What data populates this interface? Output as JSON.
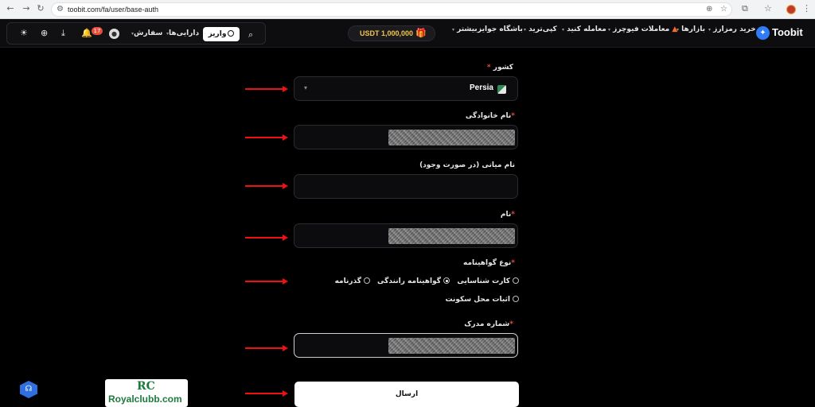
{
  "browser": {
    "url": "toobit.com/fa/user/base-auth"
  },
  "header": {
    "logo_text": "Toobit",
    "nav": [
      {
        "label": "خرید رمزارز",
        "has_menu": true
      },
      {
        "label": "بازارها",
        "has_menu": true
      },
      {
        "label": "معاملات فیوچرز",
        "has_menu": true,
        "icon": "fire-icon"
      },
      {
        "label": "معامله کنید",
        "has_menu": true
      },
      {
        "label": "کپی‌ترید",
        "has_menu": true
      },
      {
        "label": "باشگاه جوایز",
        "has_menu": false
      },
      {
        "label": "بیشتر",
        "has_menu": true
      }
    ],
    "reward_amount": "USDT 1,000,000",
    "deposit_label": "واریز",
    "assets_label": "دارایی‌ها",
    "orders_label": "سفارش",
    "notification_count": "17"
  },
  "form": {
    "country": {
      "label": "کشور",
      "value": "Persia"
    },
    "last_name": {
      "label": "نام خانوادگی"
    },
    "middle_name": {
      "label": "نام میانی (در صورت وجود)"
    },
    "first_name": {
      "label": "نام"
    },
    "cert_type": {
      "label": "نوع گواهینامه",
      "options": [
        "کارت شناسایی",
        "گواهینامه رانندگی",
        "گذرنامه",
        "اثبات محل سکونت"
      ],
      "selected": "گواهینامه رانندگی"
    },
    "doc_number": {
      "label": "شماره مدرک"
    },
    "required_mark": "*",
    "submit_label": "ارسال"
  },
  "watermark": {
    "mark": "RC",
    "text": "Royalclubb.com"
  },
  "colors": {
    "accent": "#2f7cf6",
    "arrow": "#ee1111",
    "required": "#e74c3c",
    "reward": "#f3c54a"
  }
}
